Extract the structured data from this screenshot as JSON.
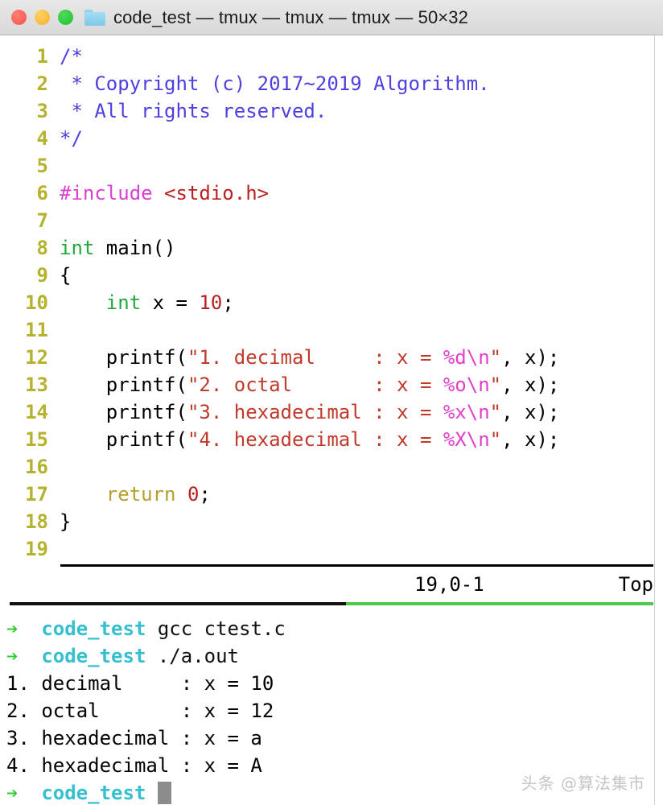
{
  "window": {
    "title": "code_test — tmux — tmux — tmux — 50×32",
    "traffic_lights": [
      {
        "name": "close",
        "color": "#f75148"
      },
      {
        "name": "minimize",
        "color": "#f7b125"
      },
      {
        "name": "zoom",
        "color": "#1fc030"
      }
    ],
    "folder_icon": "folder-icon"
  },
  "editor": {
    "lines": [
      {
        "no": "1",
        "segments": [
          {
            "t": "/*",
            "c": "c-comment"
          }
        ]
      },
      {
        "no": "2",
        "segments": [
          {
            "t": " * Copyright (c) 2017~2019 Algorithm.",
            "c": "c-comment"
          }
        ]
      },
      {
        "no": "3",
        "segments": [
          {
            "t": " * All rights reserved.",
            "c": "c-comment"
          }
        ]
      },
      {
        "no": "4",
        "segments": [
          {
            "t": "*/",
            "c": "c-comment"
          }
        ]
      },
      {
        "no": "5",
        "segments": [
          {
            "t": "",
            "c": "c-plain"
          }
        ]
      },
      {
        "no": "6",
        "segments": [
          {
            "t": "#include ",
            "c": "c-pre"
          },
          {
            "t": "<stdio.h>",
            "c": "c-header"
          }
        ]
      },
      {
        "no": "7",
        "segments": [
          {
            "t": "",
            "c": "c-plain"
          }
        ]
      },
      {
        "no": "8",
        "segments": [
          {
            "t": "int",
            "c": "c-type"
          },
          {
            "t": " main()",
            "c": "c-plain"
          }
        ]
      },
      {
        "no": "9",
        "segments": [
          {
            "t": "{",
            "c": "c-plain"
          }
        ]
      },
      {
        "no": "10",
        "segments": [
          {
            "t": "    ",
            "c": "c-plain"
          },
          {
            "t": "int",
            "c": "c-type"
          },
          {
            "t": " x = ",
            "c": "c-plain"
          },
          {
            "t": "10",
            "c": "c-num"
          },
          {
            "t": ";",
            "c": "c-plain"
          }
        ]
      },
      {
        "no": "11",
        "segments": [
          {
            "t": "",
            "c": "c-plain"
          }
        ]
      },
      {
        "no": "12",
        "segments": [
          {
            "t": "    printf(",
            "c": "c-plain"
          },
          {
            "t": "\"1. decimal     : x = ",
            "c": "c-str"
          },
          {
            "t": "%d\\n",
            "c": "c-fmt"
          },
          {
            "t": "\"",
            "c": "c-str"
          },
          {
            "t": ", x);",
            "c": "c-plain"
          }
        ]
      },
      {
        "no": "13",
        "segments": [
          {
            "t": "    printf(",
            "c": "c-plain"
          },
          {
            "t": "\"2. octal       : x = ",
            "c": "c-str"
          },
          {
            "t": "%o\\n",
            "c": "c-fmt"
          },
          {
            "t": "\"",
            "c": "c-str"
          },
          {
            "t": ", x);",
            "c": "c-plain"
          }
        ]
      },
      {
        "no": "14",
        "segments": [
          {
            "t": "    printf(",
            "c": "c-plain"
          },
          {
            "t": "\"3. hexadecimal : x = ",
            "c": "c-str"
          },
          {
            "t": "%x\\n",
            "c": "c-fmt"
          },
          {
            "t": "\"",
            "c": "c-str"
          },
          {
            "t": ", x);",
            "c": "c-plain"
          }
        ]
      },
      {
        "no": "15",
        "segments": [
          {
            "t": "    printf(",
            "c": "c-plain"
          },
          {
            "t": "\"4. hexadecimal : x = ",
            "c": "c-str"
          },
          {
            "t": "%X\\n",
            "c": "c-fmt"
          },
          {
            "t": "\"",
            "c": "c-str"
          },
          {
            "t": ", x);",
            "c": "c-plain"
          }
        ]
      },
      {
        "no": "16",
        "segments": [
          {
            "t": "",
            "c": "c-plain"
          }
        ]
      },
      {
        "no": "17",
        "segments": [
          {
            "t": "    ",
            "c": "c-plain"
          },
          {
            "t": "return",
            "c": "c-kw"
          },
          {
            "t": " ",
            "c": "c-plain"
          },
          {
            "t": "0",
            "c": "c-num"
          },
          {
            "t": ";",
            "c": "c-plain"
          }
        ]
      },
      {
        "no": "18",
        "segments": [
          {
            "t": "}",
            "c": "c-plain"
          }
        ]
      },
      {
        "no": "19",
        "segments": [
          {
            "t": "",
            "c": "c-plain"
          }
        ]
      }
    ],
    "status": {
      "position": "19,0-1",
      "scroll": "Top"
    }
  },
  "terminal": {
    "prompt_arrow": "➔",
    "cwd": "code_test",
    "lines": [
      {
        "type": "prompt",
        "arrow": "➔",
        "cwd": "code_test",
        "command": " gcc ctest.c"
      },
      {
        "type": "prompt",
        "arrow": "➔",
        "cwd": "code_test",
        "command": " ./a.out"
      },
      {
        "type": "output",
        "text": "1. decimal     : x = 10"
      },
      {
        "type": "output",
        "text": "2. octal       : x = 12"
      },
      {
        "type": "output",
        "text": "3. hexadecimal : x = a"
      },
      {
        "type": "output",
        "text": "4. hexadecimal : x = A"
      },
      {
        "type": "prompt",
        "arrow": "➔",
        "cwd": "code_test",
        "command": " ",
        "cursor": true
      }
    ]
  },
  "watermark": {
    "text": "头条 @算法集市"
  },
  "colors": {
    "comment": "#4d3fe0",
    "preprocessor": "#d93fd0",
    "header": "#bb2020",
    "type": "#1faa3c",
    "number": "#bb2020",
    "string": "#c0392b",
    "format": "#e040c9",
    "keyword": "#b5a02e",
    "lineno": "#b5b22e",
    "prompt_arrow": "#2ecc2e",
    "prompt_cwd": "#36bfce",
    "split_green": "#4ec94e",
    "cursor": "#8c8c8c"
  }
}
